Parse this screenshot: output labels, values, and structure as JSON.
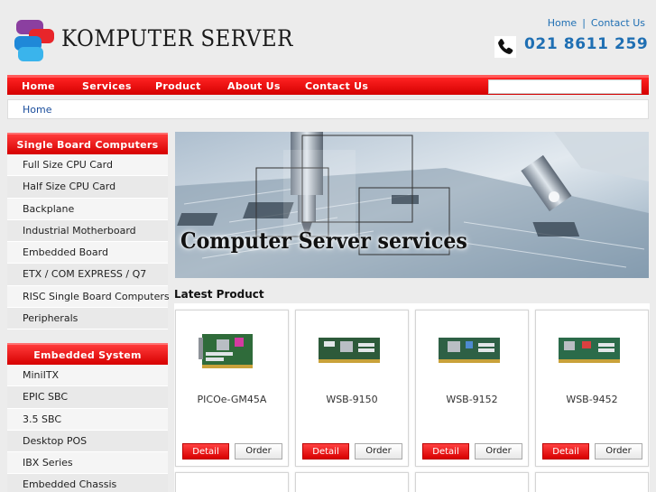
{
  "brand": {
    "name": "KOMPUTER SERVER"
  },
  "top_links": {
    "home": "Home",
    "separator": "|",
    "contact": "Contact Us"
  },
  "phone": "021 8611 259",
  "nav": [
    "Home",
    "Services",
    "Product",
    "About Us",
    "Contact Us"
  ],
  "search": {
    "placeholder": ""
  },
  "breadcrumb": "Home",
  "categories": [
    {
      "title": "Single Board Computers",
      "items": [
        "Full Size CPU Card",
        "Half Size CPU Card",
        "Backplane",
        "Industrial Motherboard",
        "Embedded Board",
        "ETX / COM EXPRESS / Q7",
        "RISC Single Board Computers",
        "Peripherals"
      ]
    },
    {
      "title": "Embedded System",
      "items": [
        "MiniITX",
        "EPIC SBC",
        "3.5 SBC",
        "Desktop POS",
        "IBX Series",
        "Embedded Chassis"
      ]
    }
  ],
  "banner": {
    "title": "Computer Server services"
  },
  "latest": {
    "title": "Latest Product",
    "products": [
      {
        "name": "PICOe-GM45A",
        "detail": "Detail",
        "order": "Order"
      },
      {
        "name": "WSB-9150",
        "detail": "Detail",
        "order": "Order"
      },
      {
        "name": "WSB-9152",
        "detail": "Detail",
        "order": "Order"
      },
      {
        "name": "WSB-9452",
        "detail": "Detail",
        "order": "Order"
      }
    ]
  },
  "colors": {
    "accent_red": "#e10000",
    "link_blue": "#1f6fb3",
    "page_bg": "#ececec"
  }
}
